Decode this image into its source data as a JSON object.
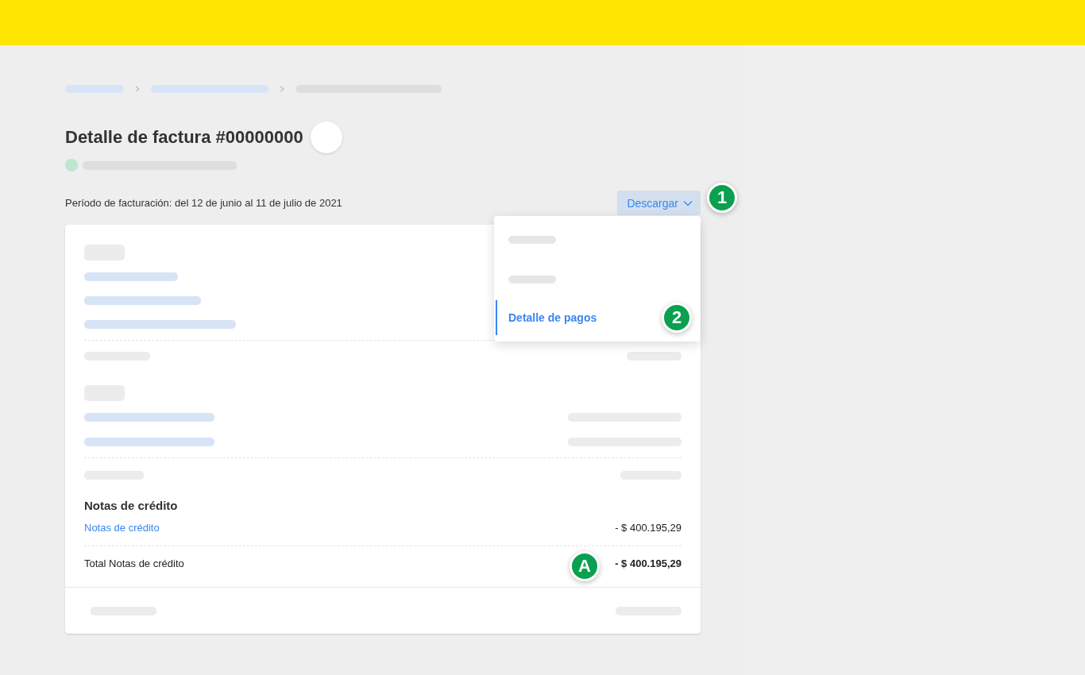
{
  "page": {
    "title": "Detalle de factura #00000000",
    "billing_period": "Período de facturación: del 12 de junio al 11 de julio de 2021"
  },
  "download_button": {
    "label": "Descargar",
    "expanded": true
  },
  "download_menu": {
    "items": [
      {
        "kind": "placeholder",
        "selected": false
      },
      {
        "kind": "placeholder",
        "selected": false
      },
      {
        "kind": "text",
        "label": "Detalle de pagos",
        "selected": true
      }
    ]
  },
  "credit_notes": {
    "heading": "Notas de crédito",
    "link": "Notas de crédito",
    "amount": "- $ 400.195,29",
    "total_label": "Total Notas de crédito",
    "total_amount": "- $ 400.195,29"
  },
  "callouts": [
    {
      "label": "1"
    },
    {
      "label": "2"
    },
    {
      "label": "A"
    }
  ]
}
